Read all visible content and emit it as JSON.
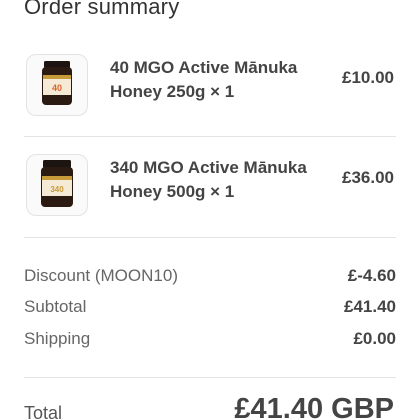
{
  "header": {
    "title": "Order summary"
  },
  "items": [
    {
      "name": "40 MGO Active Mānuka Honey 250g × 1",
      "price": "£10.00",
      "thumb_icon": "honey-jar-icon",
      "jar_label": "40"
    },
    {
      "name": "340 MGO Active Mānuka Honey 500g × 1",
      "price": "£36.00",
      "thumb_icon": "honey-jar-icon",
      "jar_label": "340"
    }
  ],
  "summary": {
    "discount_label": "Discount (MOON10)",
    "discount_value": "£-4.60",
    "subtotal_label": "Subtotal",
    "subtotal_value": "£41.40",
    "shipping_label": "Shipping",
    "shipping_value": "£0.00"
  },
  "total": {
    "label": "Total",
    "value": "£41.40 GBP"
  },
  "colors": {
    "jar_dark": "#2a1a12",
    "jar_lid": "#1c1410",
    "label_cream": "#f4ead6",
    "label_gold": "#c79a3a",
    "label_orange": "#d9642a"
  }
}
